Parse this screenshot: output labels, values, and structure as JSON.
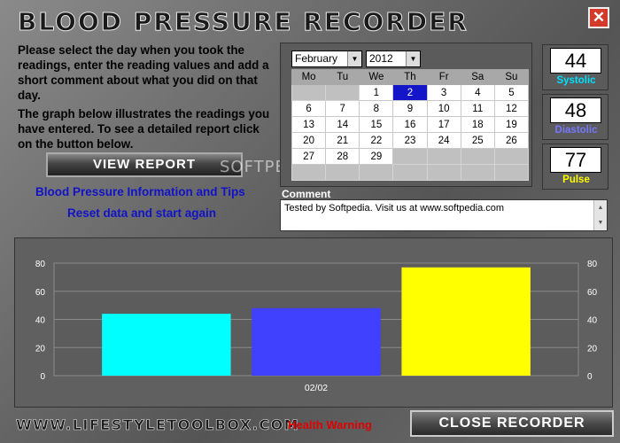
{
  "window": {
    "title": "BLOOD PRESSURE RECORDER",
    "close_glyph": "✕"
  },
  "intro": {
    "p1": "Please select the day when you took the readings, enter the reading values and add a short comment about what you did on that day.",
    "p2": "The graph below illustrates the readings you have entered. To see a detailed report click on the button below."
  },
  "buttons": {
    "view_report": "VIEW REPORT",
    "close_recorder": "CLOSE RECORDER"
  },
  "links": {
    "info": "Blood Pressure Information and Tips",
    "reset": "Reset data and start again",
    "health_warning": "Health Warning"
  },
  "calendar": {
    "month": "February",
    "year": "2012",
    "weekdays": [
      "Mo",
      "Tu",
      "We",
      "Th",
      "Fr",
      "Sa",
      "Su"
    ],
    "selected_day": "2",
    "weeks": [
      [
        "",
        "",
        "1",
        "2",
        "3",
        "4",
        "5"
      ],
      [
        "6",
        "7",
        "8",
        "9",
        "10",
        "11",
        "12"
      ],
      [
        "13",
        "14",
        "15",
        "16",
        "17",
        "18",
        "19"
      ],
      [
        "20",
        "21",
        "22",
        "23",
        "24",
        "25",
        "26"
      ],
      [
        "27",
        "28",
        "29",
        "",
        "",
        "",
        ""
      ],
      [
        "",
        "",
        "",
        "",
        "",
        "",
        ""
      ]
    ]
  },
  "comment": {
    "label": "Comment",
    "text": "Tested by Softpedia. Visit us at www.softpedia.com"
  },
  "readings": {
    "systolic": {
      "value": "44",
      "label": "Systolic",
      "color": "#00e0ff"
    },
    "diastolic": {
      "value": "48",
      "label": "Diastolic",
      "color": "#7777ff"
    },
    "pulse": {
      "value": "77",
      "label": "Pulse",
      "color": "#ffff00"
    }
  },
  "chart_data": {
    "type": "bar",
    "categories": [
      "02/02"
    ],
    "series": [
      {
        "values": [
          44
        ],
        "color": "#00ffff"
      },
      {
        "values": [
          48
        ],
        "color": "#4040ff"
      },
      {
        "values": [
          77
        ],
        "color": "#ffff00"
      }
    ],
    "yticks": [
      "0",
      "20",
      "40",
      "60",
      "80"
    ],
    "ylim": [
      0,
      80
    ],
    "grid": true
  },
  "footer": {
    "logo": "WWW.LIFESTYLETOOLBOX.COM"
  },
  "watermark": "SOFTPEDIA"
}
